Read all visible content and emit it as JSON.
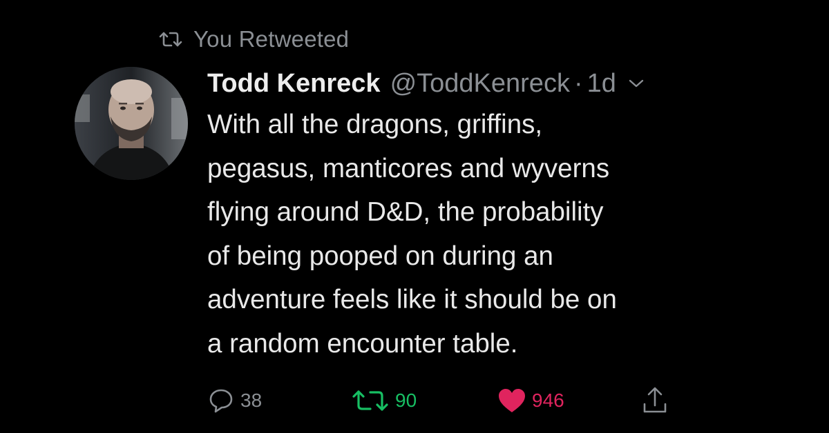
{
  "retweet_context": {
    "label": "You Retweeted",
    "icon": "retweet-icon"
  },
  "tweet": {
    "author_name": "Todd Kenreck",
    "author_handle": "@ToddKenreck",
    "separator": "·",
    "timestamp": "1d",
    "text_lines": [
      "With all the dragons, griffins,",
      "pegasus, manticores and wyverns",
      "flying around D&D, the probability",
      "of being pooped on during an",
      "adventure feels like it should be on",
      "a random encounter table."
    ]
  },
  "actions": {
    "reply_count": "38",
    "retweet_count": "90",
    "like_count": "946",
    "reply_icon": "reply-icon",
    "retweet_icon": "retweet-icon",
    "like_icon": "heart-icon",
    "share_icon": "share-icon"
  },
  "colors": {
    "background": "#000000",
    "text": "#e9e9e9",
    "muted": "#8b8f94",
    "retweet_green": "#17bf63",
    "like_red": "#e0245e"
  }
}
